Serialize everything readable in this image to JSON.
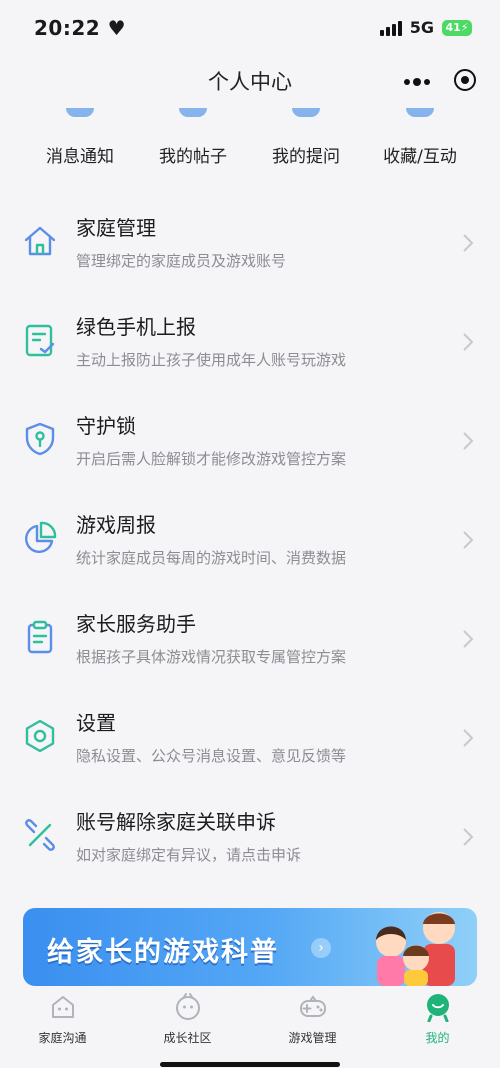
{
  "status_bar": {
    "time": "20:22",
    "network": "5G",
    "battery": "41"
  },
  "nav": {
    "title": "个人中心"
  },
  "quick_actions": [
    {
      "label": "消息通知",
      "icon": "bell-icon"
    },
    {
      "label": "我的帖子",
      "icon": "post-icon"
    },
    {
      "label": "我的提问",
      "icon": "question-icon"
    },
    {
      "label": "收藏/互动",
      "icon": "star-icon"
    }
  ],
  "menu": [
    {
      "title": "家庭管理",
      "subtitle": "管理绑定的家庭成员及游戏账号",
      "icon": "home-icon"
    },
    {
      "title": "绿色手机上报",
      "subtitle": "主动上报防止孩子使用成年人账号玩游戏",
      "icon": "report-icon"
    },
    {
      "title": "守护锁",
      "subtitle": "开启后需人脸解锁才能修改游戏管控方案",
      "icon": "shield-lock-icon"
    },
    {
      "title": "游戏周报",
      "subtitle": "统计家庭成员每周的游戏时间、消费数据",
      "icon": "pie-chart-icon"
    },
    {
      "title": "家长服务助手",
      "subtitle": "根据孩子具体游戏情况获取专属管控方案",
      "icon": "clipboard-icon"
    },
    {
      "title": "设置",
      "subtitle": "隐私设置、公众号消息设置、意见反馈等",
      "icon": "settings-icon"
    },
    {
      "title": "账号解除家庭关联申诉",
      "subtitle": "如对家庭绑定有异议，请点击申诉",
      "icon": "unlink-icon"
    }
  ],
  "banner": {
    "text": "给家长的游戏科普"
  },
  "tabs": [
    {
      "label": "家庭沟通",
      "icon": "chat-icon"
    },
    {
      "label": "成长社区",
      "icon": "community-icon"
    },
    {
      "label": "游戏管理",
      "icon": "gamepad-icon"
    },
    {
      "label": "我的",
      "icon": "profile-icon",
      "active": true
    }
  ],
  "colors": {
    "accent": "#1fb37a",
    "icon_blue": "#5b8ee8",
    "icon_teal": "#2fbf9d",
    "banner": "#3a8ff0"
  }
}
